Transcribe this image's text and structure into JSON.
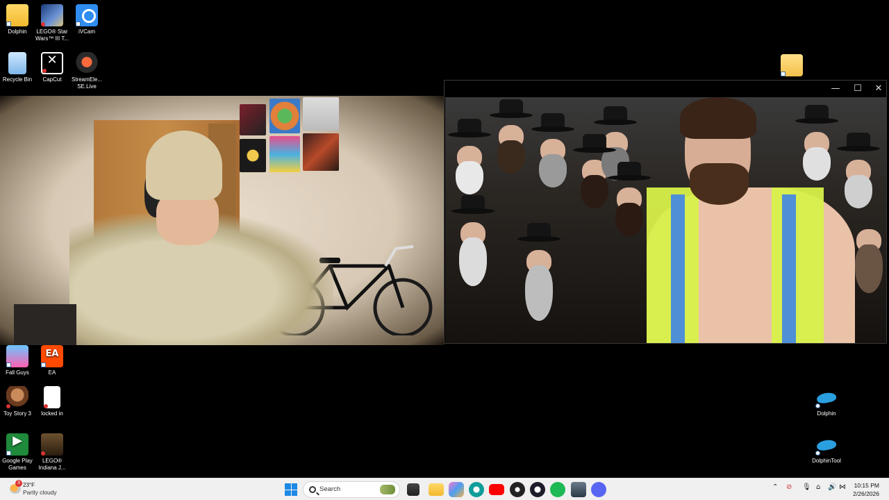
{
  "desktop_icons": {
    "dolphin_folder": "Dolphin",
    "lego_star_wars": "LEGO® Star Wars™ III T...",
    "ivcam": "iVCam",
    "recycle_bin": "Recycle Bin",
    "capcut": "CapCut",
    "streamelements": "StreamEle... SE.Live",
    "fall_guys": "Fall Guys",
    "ea": "EA",
    "toy_story": "Toy Story 3",
    "locked_in": "locked in",
    "google_play": "Google Play Games",
    "lego_indiana": "LEGO® Indiana J...",
    "dolphin_right": "Dolphin",
    "dolphintool": "DolphinTool"
  },
  "window": {
    "minimize": "—",
    "maximize": "☐",
    "close": "✕"
  },
  "taskbar": {
    "weather_temp": "23°F",
    "weather_cond": "Partly cloudy",
    "weather_badge": "3",
    "search_placeholder": "Search",
    "time": "10:15 PM",
    "date": "2/26/2026",
    "apps": [
      "file-explorer-icon",
      "task-view-icon",
      "folder-icon",
      "copilot-icon",
      "edge-icon",
      "youtube-icon",
      "obs-icon",
      "discord-like-icon",
      "spotify-icon",
      "photos-icon",
      "discord-icon"
    ],
    "colors": {
      "windows_blue": "#1e88e5",
      "youtube": "#ff0000",
      "spotify": "#1db954",
      "edge": "#0f9d9a",
      "discord": "#5865f2"
    }
  }
}
